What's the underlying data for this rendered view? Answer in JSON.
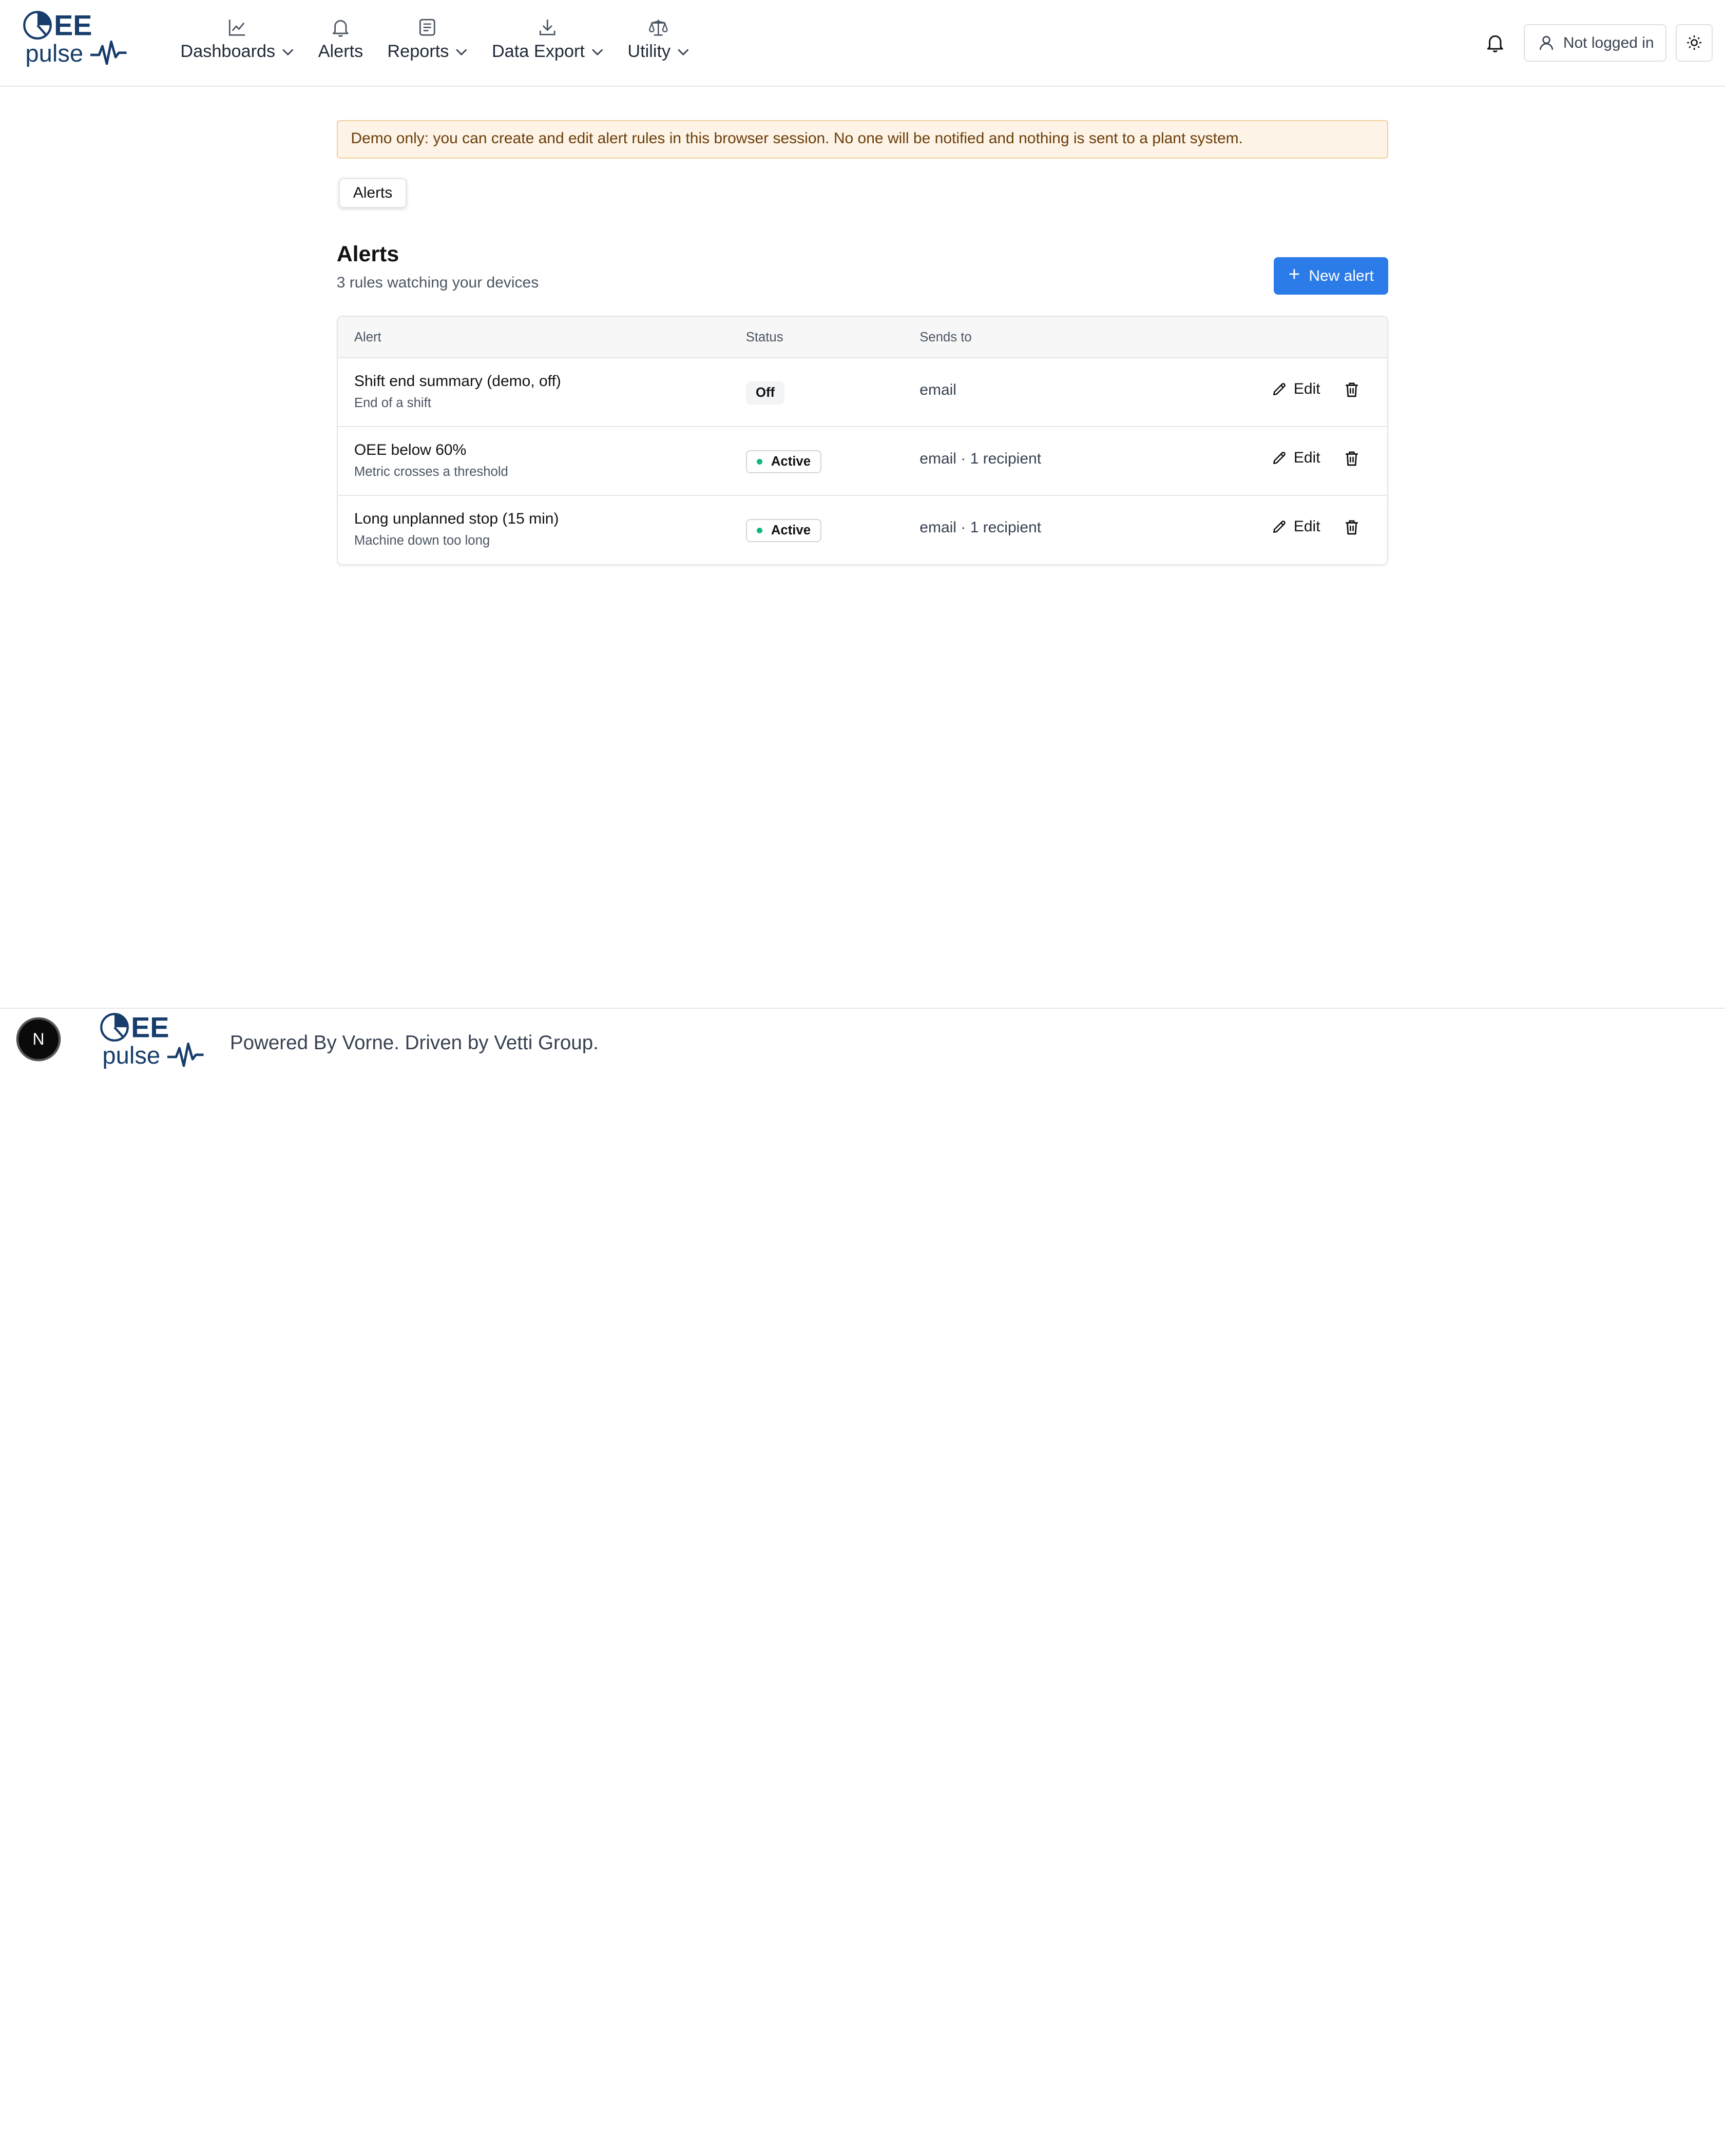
{
  "header": {
    "logo": {
      "line1": "EE",
      "line2": "pulse"
    },
    "nav": [
      {
        "label": "Dashboards",
        "icon": "chart-line-icon",
        "has_dropdown": true
      },
      {
        "label": "Alerts",
        "icon": "bell-icon",
        "has_dropdown": false
      },
      {
        "label": "Reports",
        "icon": "document-icon",
        "has_dropdown": true
      },
      {
        "label": "Data Export",
        "icon": "download-icon",
        "has_dropdown": true
      },
      {
        "label": "Utility",
        "icon": "scale-icon",
        "has_dropdown": true
      }
    ],
    "user_label": "Not logged in"
  },
  "main": {
    "banner_text": "Demo only: you can create and edit alert rules in this browser session. No one will be notified and nothing is sent to a plant system.",
    "tab_label": "Alerts",
    "title": "Alerts",
    "subtitle": "3 rules watching your devices",
    "new_alert_label": "New alert",
    "table": {
      "headers": {
        "alert": "Alert",
        "status": "Status",
        "sends_to": "Sends to"
      },
      "rows": [
        {
          "name": "Shift end summary (demo, off)",
          "description": "End of a shift",
          "status": "Off",
          "sends_to": "email",
          "edit_label": "Edit"
        },
        {
          "name": "OEE below 60%",
          "description": "Metric crosses a threshold",
          "status": "Active",
          "sends_to": "email · 1 recipient",
          "edit_label": "Edit"
        },
        {
          "name": "Long unplanned stop (15 min)",
          "description": "Machine down too long",
          "status": "Active",
          "sends_to": "email · 1 recipient",
          "edit_label": "Edit"
        }
      ]
    }
  },
  "footer": {
    "badge_letter": "N",
    "text": "Powered By Vorne. Driven by Vetti Group."
  },
  "colors": {
    "brand_navy": "#163d6b",
    "primary_button": "#2b7be8",
    "banner_bg": "#fdf3e6",
    "banner_border": "#f0cf9c",
    "active_dot": "#10b981"
  }
}
